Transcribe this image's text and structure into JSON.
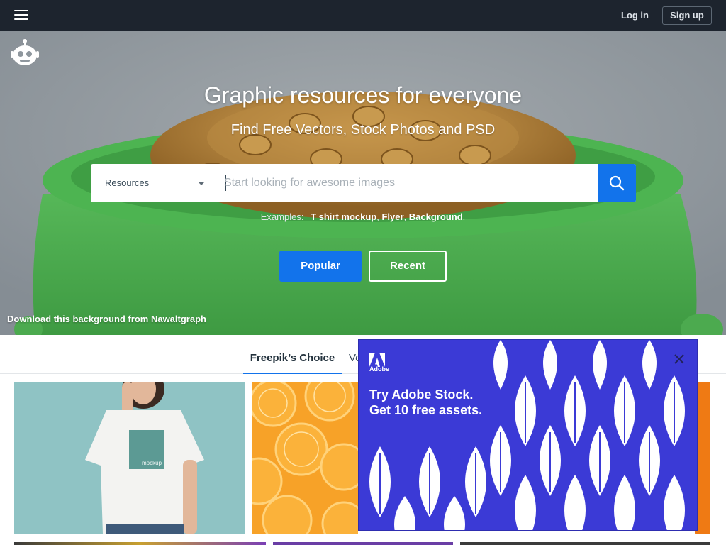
{
  "header": {
    "menu_icon": "hamburger-icon",
    "login_label": "Log in",
    "signup_label": "Sign up"
  },
  "hero": {
    "logo_icon": "freepik-logo-icon",
    "title": "Graphic resources for everyone",
    "subtitle": "Find Free Vectors, Stock Photos and PSD",
    "search": {
      "resource_selected": "Resources",
      "placeholder": "Start looking for awesome images",
      "search_icon": "search-icon"
    },
    "examples_label": "Examples:",
    "examples": [
      "T shirt mockup",
      "Flyer",
      "Background"
    ],
    "popular_label": "Popular",
    "recent_label": "Recent",
    "background_credit": "Download this background from Nawaltgraph"
  },
  "tabs": [
    {
      "label": "Freepik’s Choice",
      "active": true
    },
    {
      "label": "Ve",
      "active": false
    }
  ],
  "grid": {
    "tile1_text": "mockup"
  },
  "ad": {
    "brand": "Adobe",
    "headline_line1": "Try Adobe Stock.",
    "headline_line2": "Get 10 free assets.",
    "close_icon": "close-icon"
  },
  "colors": {
    "topbar": "#1d242e",
    "accent_blue": "#1273eb",
    "ad_blue": "#3b3ad6",
    "pot_green": "#4caa4f"
  }
}
